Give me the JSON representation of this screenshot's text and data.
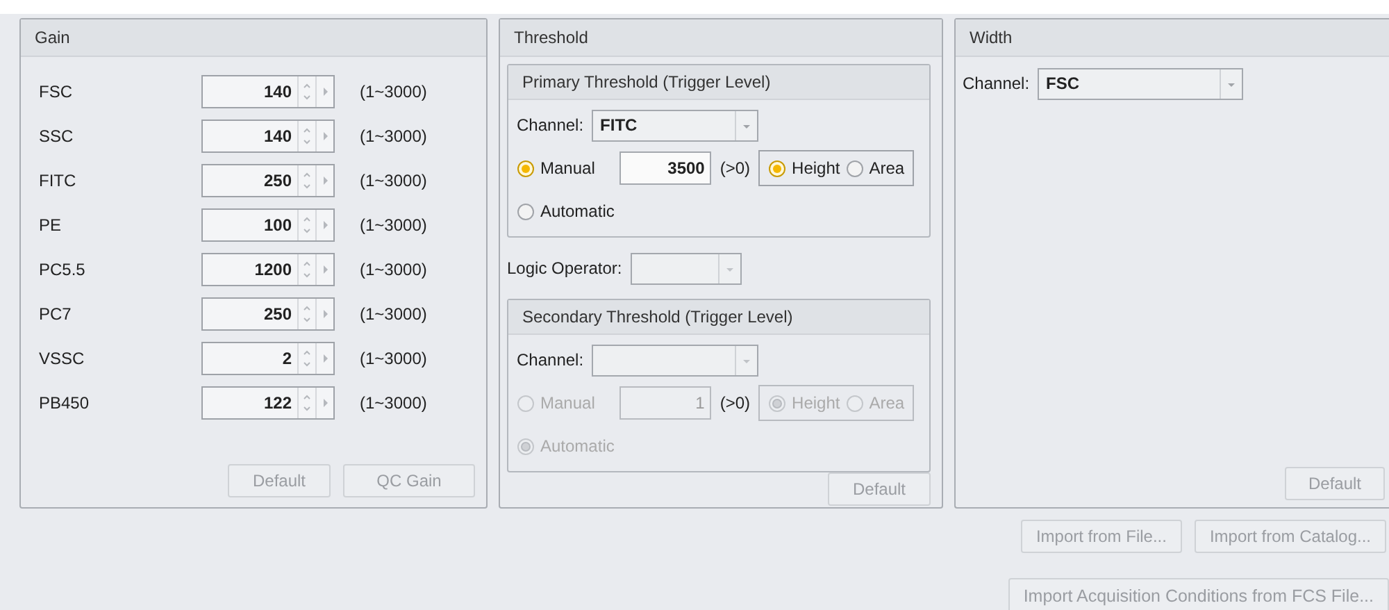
{
  "gain": {
    "title": "Gain",
    "channels": [
      {
        "name": "FSC",
        "value": "140",
        "range": "(1~3000)"
      },
      {
        "name": "SSC",
        "value": "140",
        "range": "(1~3000)"
      },
      {
        "name": "FITC",
        "value": "250",
        "range": "(1~3000)"
      },
      {
        "name": "PE",
        "value": "100",
        "range": "(1~3000)"
      },
      {
        "name": "PC5.5",
        "value": "1200",
        "range": "(1~3000)"
      },
      {
        "name": "PC7",
        "value": "250",
        "range": "(1~3000)"
      },
      {
        "name": "VSSC",
        "value": "2",
        "range": "(1~3000)"
      },
      {
        "name": "PB450",
        "value": "122",
        "range": "(1~3000)"
      }
    ],
    "buttons": [
      {
        "label": "Default",
        "disabled": true
      },
      {
        "label": "QC Gain",
        "disabled": true
      }
    ]
  },
  "threshold": {
    "title": "Threshold",
    "primary": {
      "title": "Primary Threshold (Trigger Level)",
      "disabled": false,
      "channel_label": "Channel:",
      "channel_value": "FITC",
      "value": "3500",
      "constraint": "(>0)",
      "modes": [
        {
          "label": "Manual",
          "selected": true
        },
        {
          "label": "Automatic",
          "selected": false
        }
      ],
      "measures": [
        {
          "label": "Height",
          "selected": true
        },
        {
          "label": "Area",
          "selected": false
        }
      ]
    },
    "logic_operator": {
      "label": "Logic Operator:"
    },
    "secondary": {
      "title": "Secondary Threshold (Trigger Level)",
      "disabled": true,
      "channel_label": "Channel:",
      "value": "1",
      "constraint": "(>0)",
      "modes": [
        {
          "label": "Manual",
          "selected": false
        },
        {
          "label": "Automatic",
          "selected": true
        }
      ],
      "measures": [
        {
          "label": "Height",
          "selected": true
        },
        {
          "label": "Area",
          "selected": false
        }
      ]
    },
    "button": {
      "label": "Default",
      "disabled": true
    }
  },
  "width": {
    "title": "Width",
    "channel_label": "Channel:",
    "channel_value": "FSC",
    "button": {
      "label": "Default",
      "disabled": true
    }
  },
  "actions": [
    {
      "label": "Import from File...",
      "disabled": true
    },
    {
      "label": "Import from Catalog...",
      "disabled": true
    }
  ],
  "footer": {
    "label": "Import Acquisition Conditions from FCS File...",
    "disabled": true
  }
}
